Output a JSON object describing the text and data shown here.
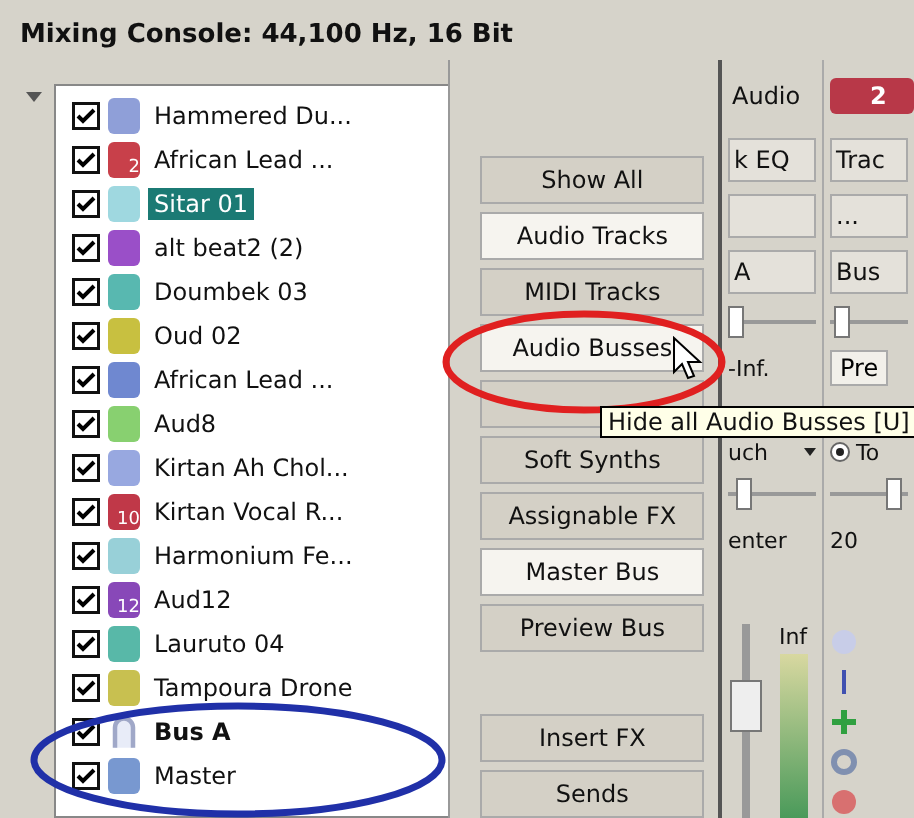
{
  "window": {
    "title": "Mixing Console: 44,100 Hz, 16 Bit"
  },
  "tracks": [
    {
      "name": "Hammered Du...",
      "checked": true,
      "selected": false,
      "color": "#8f9fd8"
    },
    {
      "name": "African Lead ...",
      "checked": true,
      "selected": false,
      "color": "#c8404a",
      "number": "2"
    },
    {
      "name": "Sitar 01",
      "checked": true,
      "selected": true,
      "color": "#9fd8e0"
    },
    {
      "name": "alt beat2 (2)",
      "checked": true,
      "selected": false,
      "color": "#9a4fc8"
    },
    {
      "name": "Doumbek 03",
      "checked": true,
      "selected": false,
      "color": "#58b8b0"
    },
    {
      "name": "Oud 02",
      "checked": true,
      "selected": false,
      "color": "#c8c040"
    },
    {
      "name": "African Lead ...",
      "checked": true,
      "selected": false,
      "color": "#6f88d0"
    },
    {
      "name": "Aud8",
      "checked": true,
      "selected": false,
      "color": "#88d070"
    },
    {
      "name": "Kirtan Ah Chol...",
      "checked": true,
      "selected": false,
      "color": "#98a8e0"
    },
    {
      "name": "Kirtan Vocal R...",
      "checked": true,
      "selected": false,
      "color": "#c03848",
      "number": "10"
    },
    {
      "name": "Harmonium Fe...",
      "checked": true,
      "selected": false,
      "color": "#98d0d8"
    },
    {
      "name": "Aud12",
      "checked": true,
      "selected": false,
      "color": "#8848b8",
      "number": "12"
    },
    {
      "name": "Lauruto 04",
      "checked": true,
      "selected": false,
      "color": "#58b8a8"
    },
    {
      "name": "Tampoura Drone",
      "checked": true,
      "selected": false,
      "color": "#c8c050"
    },
    {
      "name": "Bus A",
      "checked": true,
      "selected": false,
      "kind": "bus"
    },
    {
      "name": "Master",
      "checked": true,
      "selected": false,
      "color": "#7898d0"
    }
  ],
  "filter_buttons": [
    {
      "label": "Show All",
      "on": false
    },
    {
      "label": "Audio Tracks",
      "on": true
    },
    {
      "label": "MIDI Tracks",
      "on": false
    },
    {
      "label": "Audio Busses",
      "on": true
    },
    {
      "on": false
    },
    {
      "label": "Soft Synths",
      "on": false
    },
    {
      "label": "Assignable FX",
      "on": false
    },
    {
      "label": "Master Bus",
      "on": true
    },
    {
      "label": "Preview Bus",
      "on": false
    }
  ],
  "view_buttons": [
    {
      "label": "Insert FX"
    },
    {
      "label": "Sends"
    }
  ],
  "strip_columns": [
    {
      "cells": [
        {
          "kind": "header",
          "text": "Audio"
        },
        {
          "kind": "field",
          "text": "k EQ"
        },
        {
          "kind": "field"
        },
        {
          "kind": "field",
          "text": "A"
        },
        {
          "kind": "slider",
          "level": 0.0
        },
        {
          "kind": "label",
          "text": "-Inf."
        },
        {
          "kind": "dropdown",
          "text": "uch"
        },
        {
          "kind": "slider",
          "level": 0.1
        },
        {
          "kind": "label",
          "text": "enter"
        },
        {
          "kind": "fader",
          "text": "Inf",
          "level": 0.6
        }
      ]
    },
    {
      "cells": [
        {
          "kind": "badge",
          "text": "2"
        },
        {
          "kind": "field",
          "text": "Trac"
        },
        {
          "kind": "field",
          "text": "..."
        },
        {
          "kind": "field",
          "text": "Bus"
        },
        {
          "kind": "slider",
          "level": 0.05
        },
        {
          "kind": "toggle",
          "text": "Pre"
        },
        {
          "kind": "radio",
          "text": "To",
          "checked": true
        },
        {
          "kind": "slider",
          "level": 0.9
        },
        {
          "kind": "label",
          "text": "20"
        },
        {
          "kind": "icons"
        }
      ]
    }
  ],
  "tooltip": {
    "text": "Hide all Audio Busses [U]"
  }
}
